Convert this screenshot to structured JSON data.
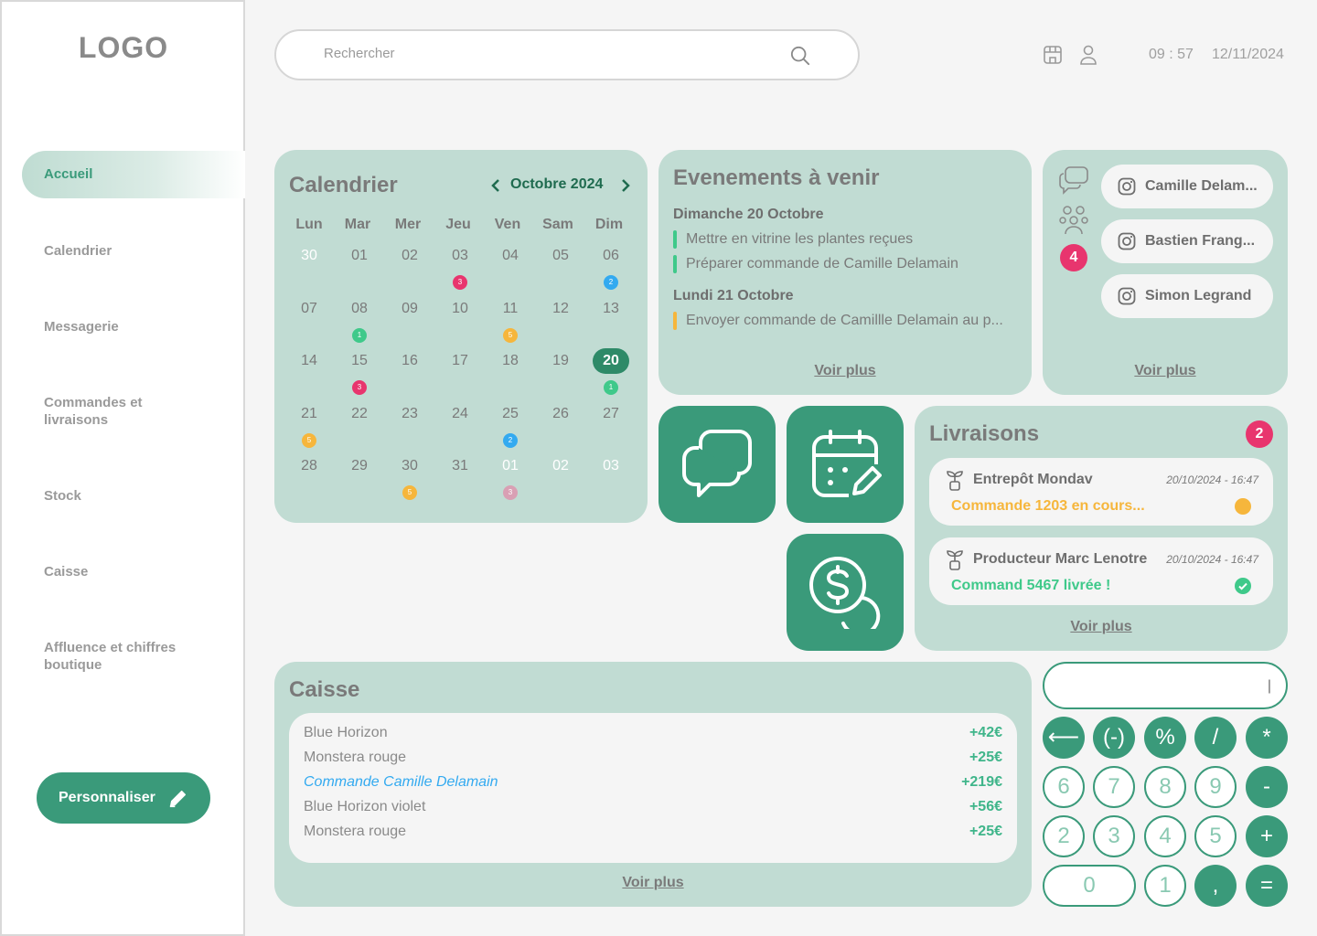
{
  "sidebar": {
    "logo": "LOGO",
    "items": [
      {
        "label": "Accueil"
      },
      {
        "label": "Calendrier"
      },
      {
        "label": "Messagerie"
      },
      {
        "label": "Commandes et livraisons"
      },
      {
        "label": "Stock"
      },
      {
        "label": "Caisse"
      },
      {
        "label": "Affluence et chiffres boutique"
      }
    ],
    "customize": "Personnaliser"
  },
  "header": {
    "search_placeholder": "Rechercher",
    "time": "09 : 57",
    "date": "12/11/2024"
  },
  "calendar": {
    "title": "Calendrier",
    "month": "Octobre 2024",
    "weekdays": [
      "Lun",
      "Mar",
      "Mer",
      "Jeu",
      "Ven",
      "Sam",
      "Dim"
    ],
    "weeks": [
      [
        "30",
        "01",
        "02",
        "03",
        "04",
        "05",
        "06"
      ],
      [
        "07",
        "08",
        "09",
        "10",
        "11",
        "12",
        "13"
      ],
      [
        "14",
        "15",
        "16",
        "17",
        "18",
        "19",
        "20"
      ],
      [
        "21",
        "22",
        "23",
        "24",
        "25",
        "26",
        "27"
      ],
      [
        "28",
        "29",
        "30",
        "31",
        "01",
        "02",
        "03"
      ]
    ],
    "markers": [
      {
        "week": 0,
        "day": 3,
        "count": "3",
        "color": "#e8356e"
      },
      {
        "week": 0,
        "day": 6,
        "count": "2",
        "color": "#33aaf0"
      },
      {
        "week": 1,
        "day": 1,
        "count": "1",
        "color": "#3fc98a"
      },
      {
        "week": 1,
        "day": 4,
        "count": "5",
        "color": "#f6b63c"
      },
      {
        "week": 2,
        "day": 1,
        "count": "3",
        "color": "#e8356e"
      },
      {
        "week": 2,
        "day": 6,
        "count": "1",
        "color": "#3fc98a"
      },
      {
        "week": 3,
        "day": 0,
        "count": "5",
        "color": "#f6b63c"
      },
      {
        "week": 3,
        "day": 4,
        "count": "2",
        "color": "#33aaf0"
      },
      {
        "week": 4,
        "day": 2,
        "count": "5",
        "color": "#f6b63c"
      },
      {
        "week": 4,
        "day": 4,
        "count": "3",
        "color": "#d9a0b4"
      }
    ]
  },
  "events": {
    "title": "Evenements à venir",
    "day1": "Dimanche 20 Octobre",
    "day1_items": [
      "Mettre en vitrine les plantes reçues",
      "Préparer commande de Camille Delamain"
    ],
    "day2": "Lundi 21 Octobre",
    "day2_items": [
      "Envoyer commande de Camillle Delamain au p..."
    ],
    "more": "Voir plus"
  },
  "contacts": {
    "badge": "4",
    "people": [
      "Camille Delam...",
      "Bastien Frang...",
      "Simon Legrand"
    ],
    "more": "Voir plus"
  },
  "deliveries": {
    "title": "Livraisons",
    "badge": "2",
    "items": [
      {
        "from": "Entrepôt Mondav",
        "when": "20/10/2024 - 16:47",
        "status": "Commande 1203 en cours...",
        "status_color": "#f6b63c"
      },
      {
        "from": "Producteur Marc Lenotre",
        "when": "20/10/2024 - 16:47",
        "status": "Command 5467 livrée !",
        "status_color": "#3fc98a"
      }
    ],
    "more": "Voir plus"
  },
  "caisse": {
    "title": "Caisse",
    "rows": [
      {
        "label": "Blue Horizon",
        "amount": "+42€"
      },
      {
        "label": "Monstera rouge",
        "amount": "+25€"
      },
      {
        "label": "Commande Camille Delamain",
        "amount": "+219€"
      },
      {
        "label": "Blue Horizon violet",
        "amount": "+56€"
      },
      {
        "label": "Monstera rouge",
        "amount": "+25€"
      }
    ],
    "more": "Voir plus"
  },
  "keypad": {
    "display": "|",
    "keys": [
      "⟵",
      "(-)",
      "%",
      "/",
      "*",
      "6",
      "7",
      "8",
      "9",
      "-",
      "2",
      "3",
      "4",
      "5",
      "+",
      "0",
      "1",
      ",",
      "="
    ]
  },
  "colors": {
    "accent": "#3a9a7a",
    "card": "#c1dcd3",
    "alert": "#e8356e"
  }
}
